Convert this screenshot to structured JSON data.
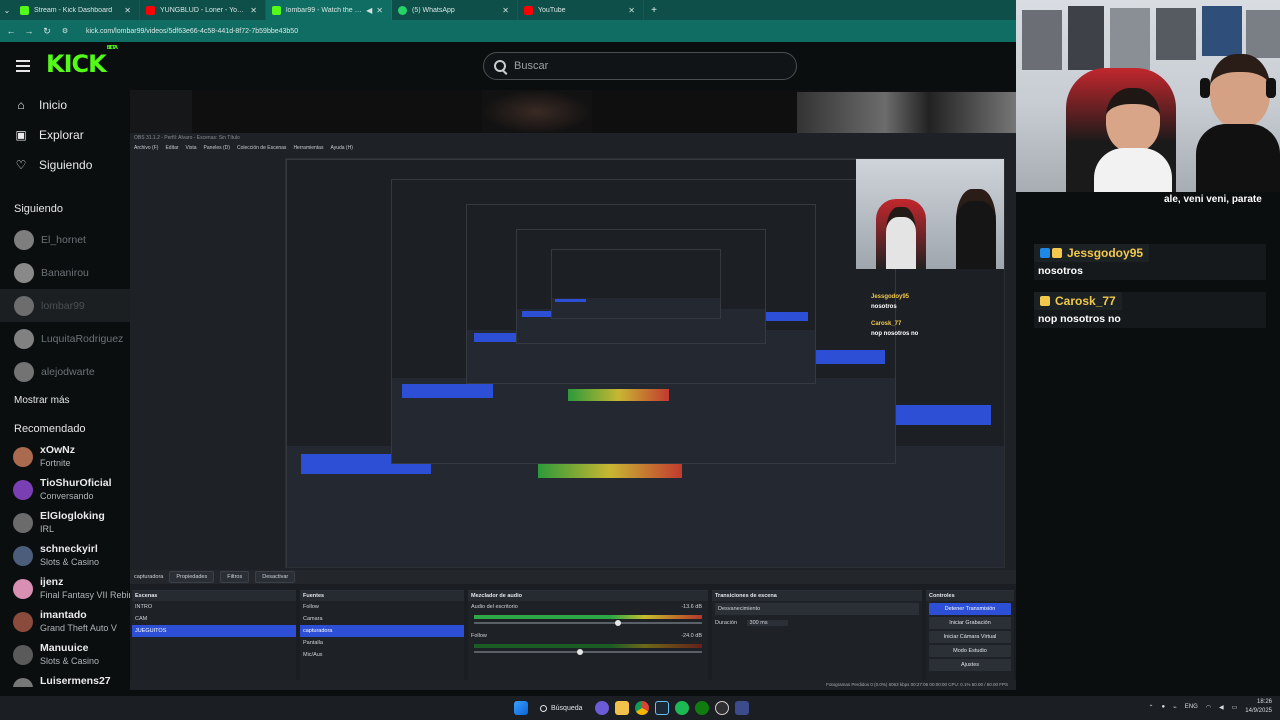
{
  "browser": {
    "tabs": [
      {
        "title": "Stream - Kick Dashboard",
        "active": false,
        "icon_color": "#53fc18"
      },
      {
        "title": "YUNGBLUD - Loner - YouTube",
        "active": false,
        "icon_color": "#ff0000"
      },
      {
        "title": "lombar99 - Watch the VOD",
        "active": true,
        "icon_color": "#53fc18"
      },
      {
        "title": "(5) WhatsApp",
        "active": false,
        "icon_color": "#25d366"
      },
      {
        "title": "YouTube",
        "active": false,
        "icon_color": "#ff0000"
      }
    ],
    "url": "kick.com/lombar99/videos/5df63e66-4c58-441d-8f72-7b59bbe43b50"
  },
  "kick": {
    "logo": "KICK",
    "logo_sup": "BETA",
    "search_placeholder": "Buscar",
    "nav": [
      {
        "label": "Inicio",
        "icon": "home-icon"
      },
      {
        "label": "Explorar",
        "icon": "explore-icon"
      },
      {
        "label": "Siguiendo",
        "icon": "heart-icon"
      }
    ],
    "following_title": "Siguiendo",
    "following": [
      {
        "name": "El_hornet",
        "color": "#7a7f84"
      },
      {
        "name": "Bananirou",
        "color": "#8d8a7a"
      },
      {
        "name": "lombar99",
        "color": "#6a6e72",
        "selected": true
      },
      {
        "name": "LuquitaRodriguez",
        "color": "#7d8286"
      },
      {
        "name": "alejodwarte",
        "color": "#6f7479"
      }
    ],
    "show_more": "Mostrar más",
    "recommended_title": "Recomendado",
    "recommended": [
      {
        "name": "xOwNz",
        "category": "Fortnite",
        "color": "#a96a4f"
      },
      {
        "name": "TioShurOficial",
        "category": "Conversando",
        "color": "#7a3fb3"
      },
      {
        "name": "ElGlogloking",
        "category": "IRL",
        "color": "#6b6b6b"
      },
      {
        "name": "schneckyirl",
        "category": "Slots & Casino",
        "color": "#4b5d7a"
      },
      {
        "name": "ijenz",
        "category": "Final Fantasy VII Rebirth",
        "color": "#d98fb3"
      },
      {
        "name": "imantado",
        "category": "Grand Theft Auto V",
        "color": "#8a4b3c"
      },
      {
        "name": "Manuuice",
        "category": "Slots & Casino",
        "color": "#5a5a5a"
      },
      {
        "name": "Luisermens27",
        "category": "",
        "color": "#777777"
      }
    ]
  },
  "obs": {
    "title": "OBS 31.1.2 - Perfil: Alvaro - Escenas: Sin Título",
    "menu": [
      "Archivo (F)",
      "Editar",
      "Vista",
      "Paneles (D)",
      "Colección de Escenas",
      "Herramientas",
      "Ayuda (H)"
    ],
    "toolbar_tabs": [
      "capturadora",
      "Propiedades",
      "Filtros",
      "Desactivar"
    ],
    "scenes_title": "Escenas",
    "scenes": [
      "INTRO",
      "CAM",
      "JUEGUITOS"
    ],
    "selected_scene": "JUEGUITOS",
    "sources_title": "Fuentes",
    "sources": [
      "Follow",
      "Camara",
      "capturadora",
      "Pantalla",
      "Mic/Aux"
    ],
    "selected_source": "capturadora",
    "mixer_title": "Mezclador de audio",
    "mixer_channels": [
      {
        "name": "Audio del escritorio",
        "db": "-13.6 dB"
      },
      {
        "name": "Follow",
        "db": "-24.0 dB"
      }
    ],
    "transitions_title": "Transiciones de escena",
    "transition": "Desvanecimiento",
    "duration_label": "Duración",
    "duration_value": "300 ms",
    "controls_title": "Controles",
    "controls": [
      "Detener Transmisión",
      "Iniciar Grabación",
      "Iniciar Cámara Virtual",
      "Modo Estudio",
      "Ajustes"
    ],
    "status": "Fotogramas Perdidos 0 (0.0%)   6063 kbps   00:27:06   00:00:00   CPU: 0.1%   60.00 / 60.00 FPS"
  },
  "chat": {
    "partial_message": "ale, veni veni, parate",
    "messages": [
      {
        "user": "Jessgodoy95",
        "text": "nosotros",
        "badge_colors": [
          "#1e88e5",
          "#f2c94c"
        ]
      },
      {
        "user": "Carosk_77",
        "text": "nop nosotros no",
        "badge_colors": [
          "#f2c94c"
        ]
      }
    ]
  },
  "inner_chat": [
    {
      "user": "Jessgodoy95",
      "text": "nosotros"
    },
    {
      "user": "Carosk_77",
      "text": "nop nosotros no"
    }
  ],
  "taskbar": {
    "search_label": "Búsqueda",
    "lang": "ENG",
    "time": "18:26",
    "date": "14/9/2025"
  }
}
